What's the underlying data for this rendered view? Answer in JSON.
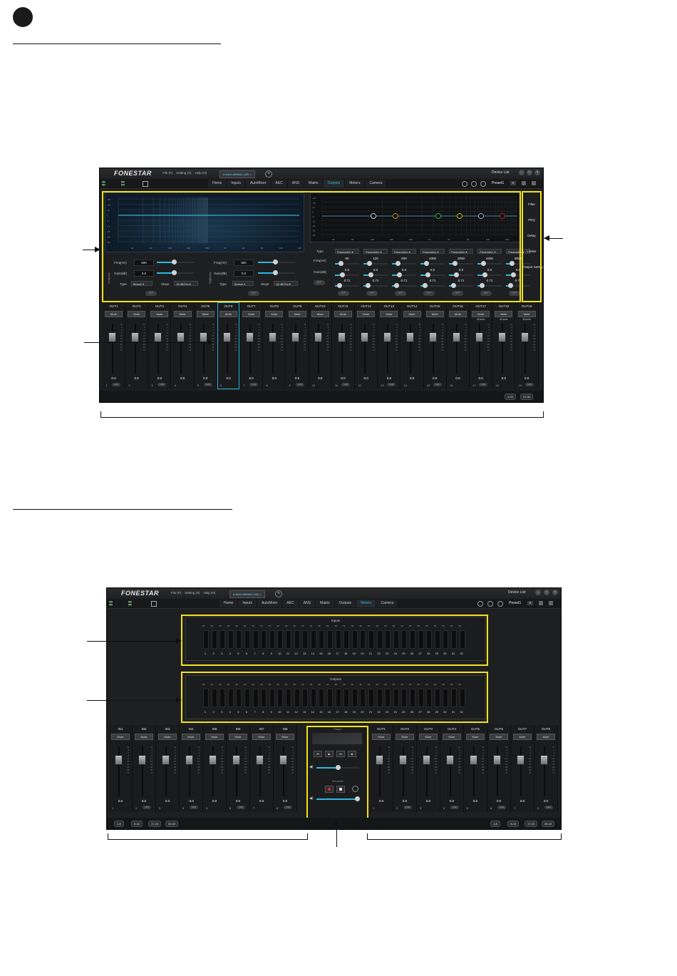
{
  "app": {
    "logo": "FONESTAR",
    "menus": [
      "File (F)",
      "Setting (S)",
      "Help (H)"
    ],
    "device_tab": "MAX-88/MAX-16D",
    "device_list": "Device List",
    "preset": "Preset1",
    "tabs": [
      "Home",
      "Inputs",
      "AutoMixer",
      "AEC",
      "ANS",
      "Matrix",
      "Outputs",
      "Meters",
      "Camera"
    ]
  },
  "screen1": {
    "active_tab": "Outputs",
    "xover": {
      "lowpass": {
        "side_label": "Lowpass",
        "freq_label": "Freq(Hz)",
        "freq": "500",
        "gain_label": "Gain(dB)",
        "gain": "0.0",
        "type_label": "Type",
        "type": "Bessel",
        "slope_label": "Slope",
        "slope": "18 dB/Oct",
        "toggle": "OFF"
      },
      "highpass": {
        "side_label": "Highpass",
        "freq_label": "Freq(Hz)",
        "freq": "500",
        "gain_label": "Gain(dB)",
        "gain": "0.0",
        "type_label": "Type",
        "type": "Bessel",
        "slope_label": "Slope",
        "slope": "18 dB/Oct",
        "toggle": "OFF"
      }
    },
    "graph_ylabels": [
      "+18",
      "+12",
      "+6",
      "0",
      "-6",
      "-12",
      "-18",
      "-24",
      "-30"
    ],
    "graph_xlabels": [
      "20",
      "50",
      "100",
      "200",
      "500",
      "1K",
      "2K",
      "5K",
      "10K",
      "20K"
    ],
    "peq": {
      "type_label": "Type",
      "freq_label": "Freq(Hz)",
      "gain_label": "Gain(dB)",
      "bands": [
        {
          "type": "Parametric",
          "freq": "60",
          "gain": "0.0",
          "q": "0.71"
        },
        {
          "type": "Parametric",
          "freq": "125",
          "gain": "0.0",
          "q": "0.71"
        },
        {
          "type": "Parametric",
          "freq": "500",
          "gain": "0.0",
          "q": "0.71"
        },
        {
          "type": "Parametric",
          "freq": "1000",
          "gain": "0.0",
          "q": "0.71"
        },
        {
          "type": "Parametric",
          "freq": "2000",
          "gain": "0.0",
          "q": "0.71"
        },
        {
          "type": "Parametric",
          "freq": "4000",
          "gain": "0.0",
          "q": "0.71"
        },
        {
          "type": "Parametric",
          "freq": "8000",
          "gain": "0.0",
          "q": "0.71"
        }
      ],
      "off_label": "OFF"
    },
    "side_menu": [
      "Filter",
      "PEQ",
      "Delay",
      "Limiter",
      "Output Setting"
    ],
    "channels": [
      "OUT1",
      "OUT2",
      "OUT3",
      "OUT4",
      "OUT5",
      "OUT6",
      "OUT7",
      "OUT8",
      "OUT9",
      "OUT10",
      "OUT11",
      "OUT12",
      "OUT13",
      "OUT14",
      "OUT15",
      "OUT16",
      "OUT17",
      "OUT18",
      "OUT19"
    ],
    "mute_label": "Mute",
    "fader_value": "0.0",
    "link_label": "Link",
    "pages": [
      "1-20",
      "21-32"
    ],
    "fader_ticks": [
      "12",
      "6",
      "0",
      "-6",
      "-12",
      "-18",
      "-24",
      "-36",
      "-48",
      "-72"
    ],
    "dante_label": "#Dante"
  },
  "screen2": {
    "active_tab": "Meters",
    "inputs_title": "Inputs",
    "outputs_title": "Outputs",
    "meter_level": "-72",
    "meter_count": 32,
    "in_channels": [
      "IN1",
      "IN2",
      "IN3",
      "IN4",
      "IN5",
      "IN6",
      "IN7",
      "IN8"
    ],
    "in_values": [
      "0.0",
      "0.0",
      "0.0",
      "-3.0",
      "0.0",
      "0.0",
      "0.0",
      "0.0"
    ],
    "out_channels": [
      "OUT1",
      "OUT2",
      "OUT3",
      "OUT4",
      "OUT5",
      "OUT6",
      "OUT7",
      "OUT8"
    ],
    "out_values": [
      "0.0",
      "0.0",
      "0.0",
      "0.0",
      "0.0",
      "0.0",
      "0.0",
      "0.0"
    ],
    "player_title": "Player",
    "recorder_title": "Recorder",
    "pages": [
      "1-8",
      "9-16",
      "17-24",
      "25-32"
    ]
  }
}
